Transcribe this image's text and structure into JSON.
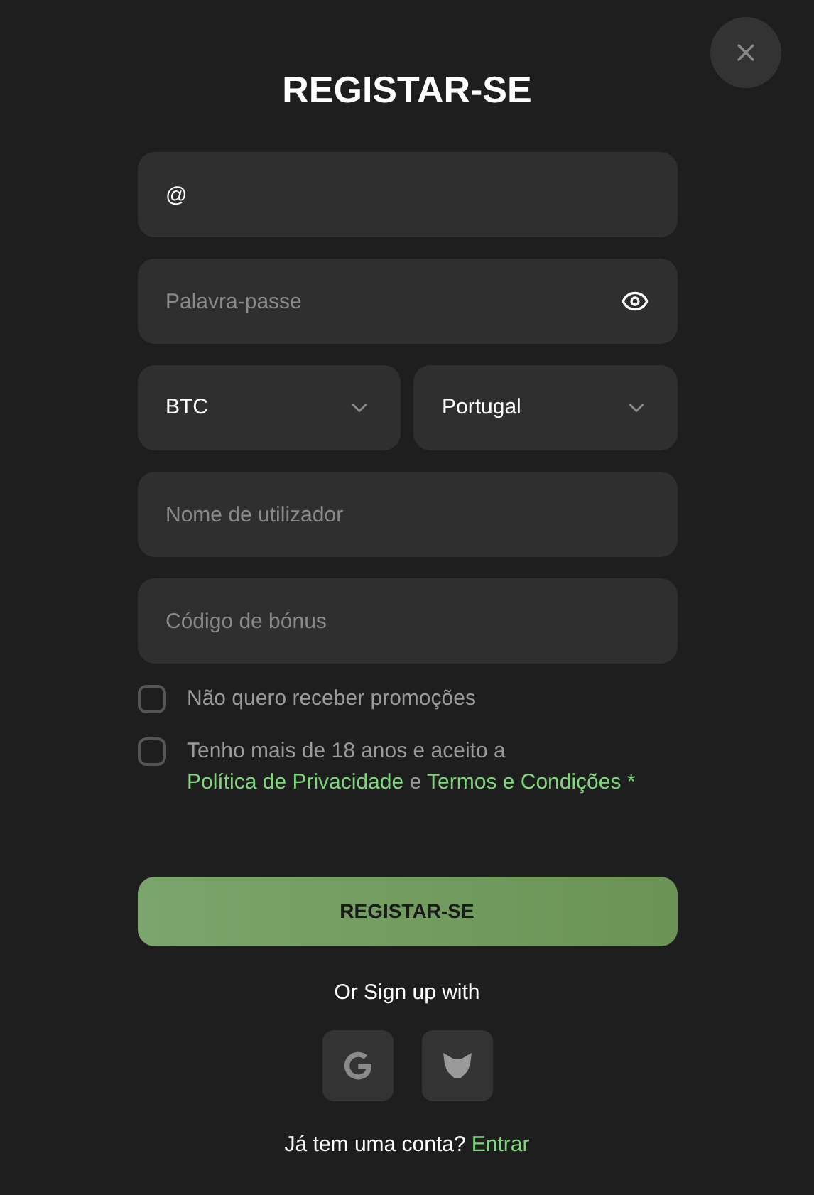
{
  "title": "REGISTAR-SE",
  "fields": [
    {
      "kind": "text",
      "value": "@"
    },
    {
      "kind": "password",
      "placeholder": "Palavra-passe"
    },
    {
      "kind": "selects",
      "options": [
        {
          "value": "BTC"
        },
        {
          "value": "Portugal"
        }
      ]
    },
    {
      "kind": "text",
      "placeholder": "Nome de utilizador"
    },
    {
      "kind": "text",
      "placeholder": "Código de bónus"
    }
  ],
  "checkboxes": [
    {
      "checked": false,
      "parts": [
        {
          "kind": "text",
          "text": "Não quero receber promoções"
        }
      ]
    },
    {
      "checked": false,
      "parts": [
        {
          "kind": "text",
          "text": "Tenho mais de 18 anos e aceito a"
        },
        {
          "kind": "link",
          "text": "Política de Privacidade"
        },
        {
          "kind": "text",
          "text": "e"
        },
        {
          "kind": "link",
          "text": "Termos e Condições"
        },
        {
          "kind": "link",
          "text": "*"
        }
      ]
    }
  ],
  "submit": "REGISTAR-SE",
  "social": {
    "label": "Or Sign up with",
    "providers": [
      {
        "kind": "google"
      },
      {
        "kind": "fox"
      }
    ]
  },
  "footer": {
    "text": "Já tem uma conta?",
    "link": "Entrar"
  }
}
